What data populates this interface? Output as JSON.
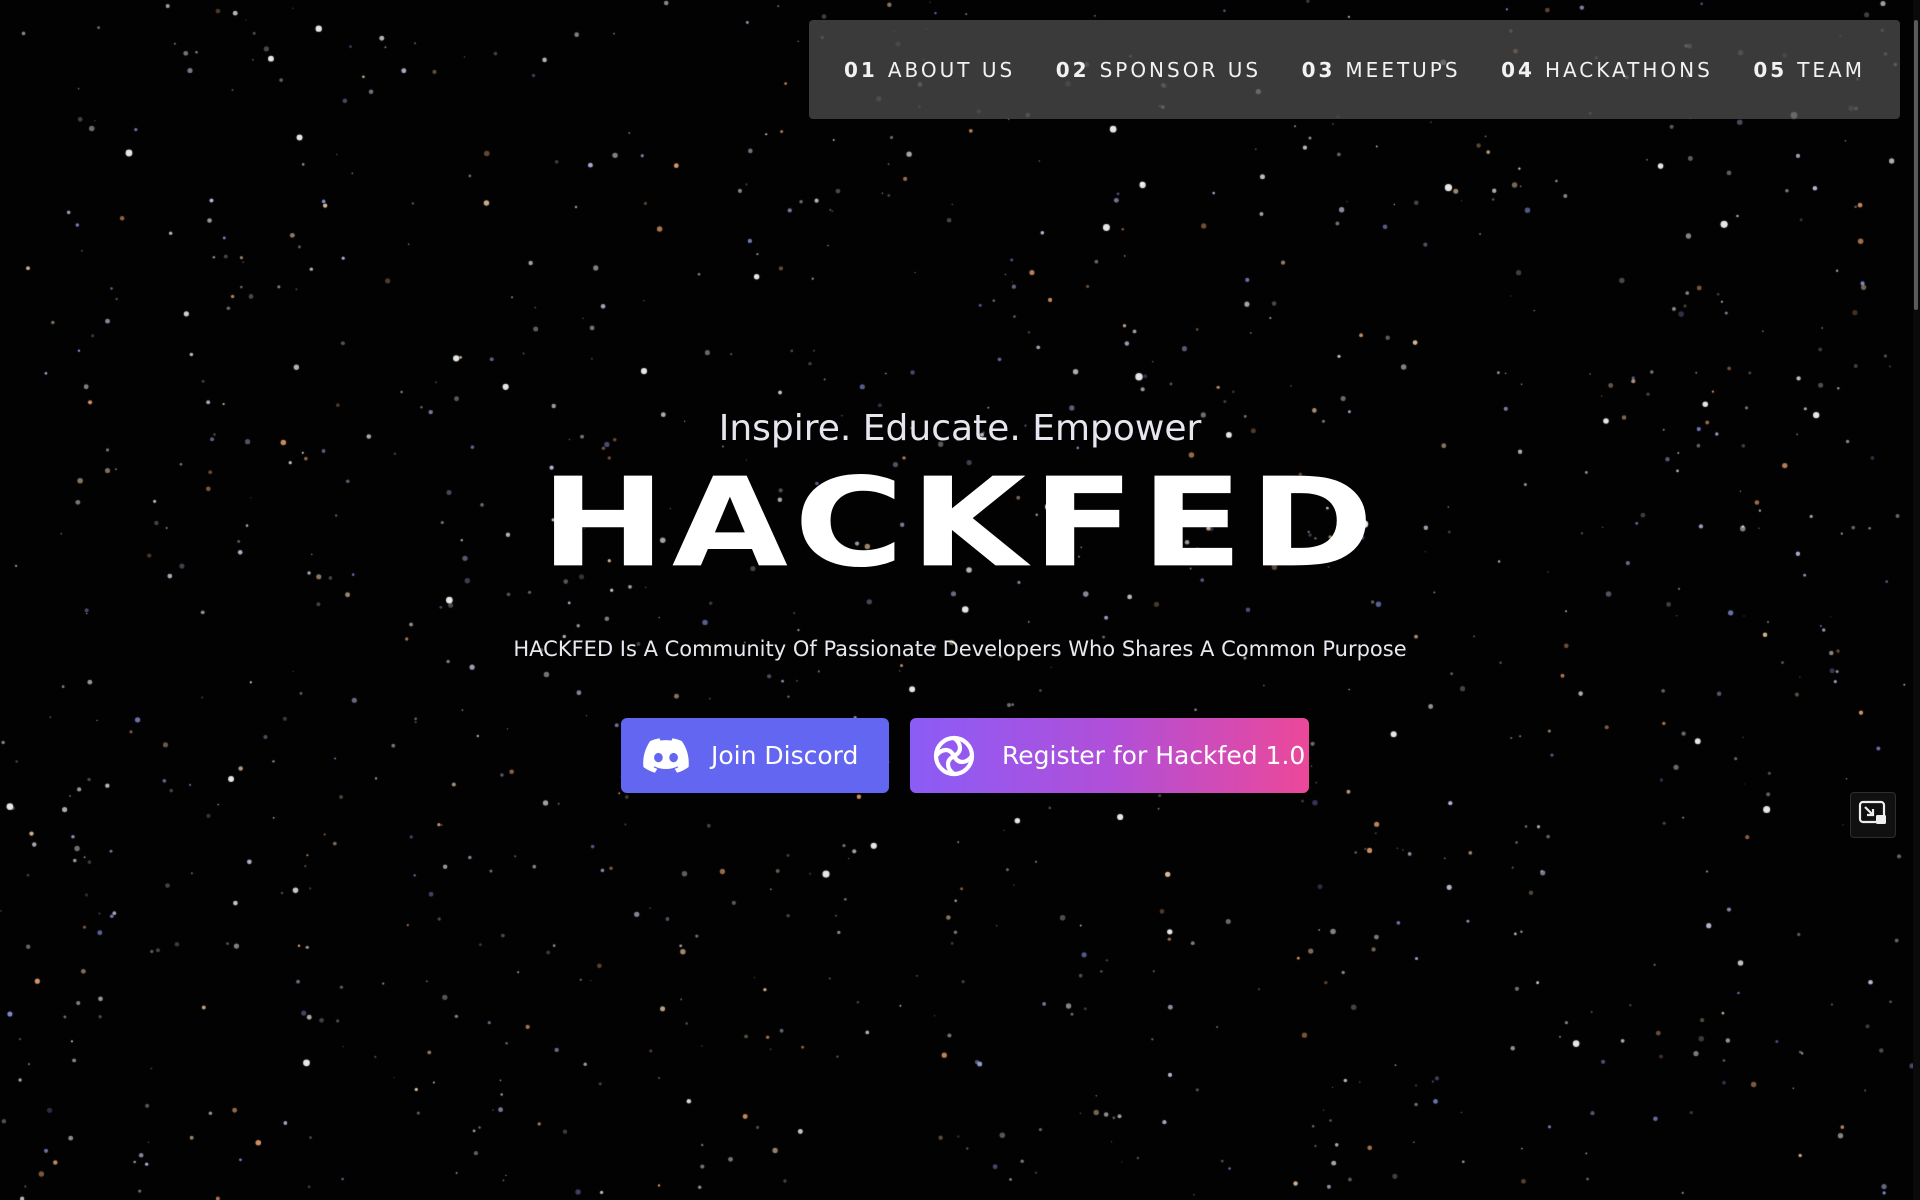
{
  "nav": {
    "items": [
      {
        "num": "01",
        "label": "ABOUT US"
      },
      {
        "num": "02",
        "label": "SPONSOR US"
      },
      {
        "num": "03",
        "label": "MEETUPS"
      },
      {
        "num": "04",
        "label": "HACKATHONS"
      },
      {
        "num": "05",
        "label": "TEAM"
      }
    ]
  },
  "hero": {
    "tagline": "Inspire. Educate. Empower",
    "title": "HACKFED",
    "description": "HACKFED Is A Community Of Passionate Developers Who Shares A Common Purpose"
  },
  "buttons": {
    "discord_label": "Join Discord",
    "register_label": "Register for Hackfed 1.0",
    "discord_icon": "discord-icon",
    "register_icon": "swirl-logo-icon"
  },
  "colors": {
    "background": "#000000",
    "discord_button": "#6366f1",
    "register_gradient_start": "#8b5cf6",
    "register_gradient_end": "#ec4899"
  }
}
